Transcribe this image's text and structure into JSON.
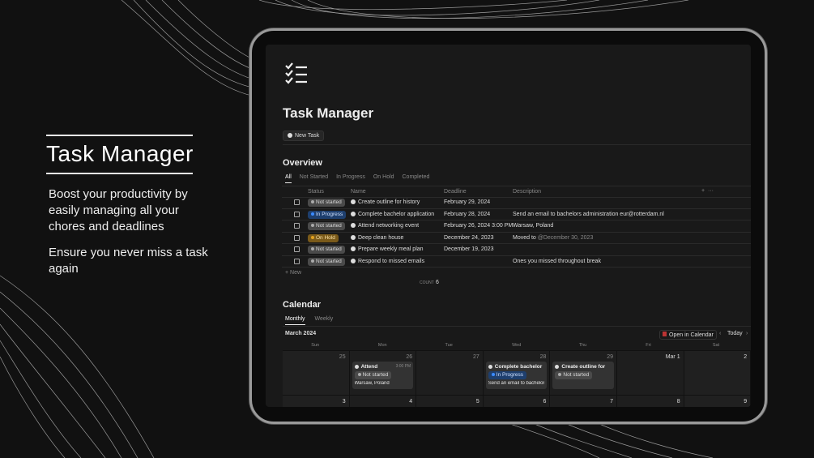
{
  "hero": {
    "title": "Task Manager",
    "paragraph1": "Boost your productivity by easily managing all your chores and deadlines",
    "paragraph2": "Ensure you never miss a task again"
  },
  "page": {
    "title": "Task Manager",
    "new_task_label": "New Task",
    "icon": "checklist-icon"
  },
  "overview": {
    "heading": "Overview",
    "tabs": [
      "All",
      "Not Started",
      "In Progress",
      "On Hold",
      "Completed"
    ],
    "columns": [
      "Status",
      "Name",
      "Deadline",
      "Description"
    ],
    "rows": [
      {
        "status": "Not started",
        "status_type": "ns",
        "name": "Create outline for history",
        "deadline": "February 29, 2024",
        "description": ""
      },
      {
        "status": "In Progress",
        "status_type": "ip",
        "name": "Complete bachelor application",
        "deadline": "February 28, 2024",
        "description": "Send an email to bachelors administration eur@rotterdam.nl"
      },
      {
        "status": "Not started",
        "status_type": "ns",
        "name": "Attend networking event",
        "deadline": "February 26, 2024 3:00 PM",
        "description": "Warsaw, Poland"
      },
      {
        "status": "On Hold",
        "status_type": "oh",
        "name": "Deep clean house",
        "deadline": "December 24, 2023",
        "description": "Moved to",
        "description_mention": "@December 30, 2023"
      },
      {
        "status": "Not started",
        "status_type": "ns",
        "name": "Prepare weekly meal plan",
        "deadline": "December 19, 2023",
        "description": ""
      },
      {
        "status": "Not started",
        "status_type": "ns",
        "name": "Respond to missed emails",
        "deadline": "",
        "description": "Ones you missed throughout break"
      }
    ],
    "new_label": "+ New",
    "count_label": "COUNT",
    "count": "6"
  },
  "calendar": {
    "heading": "Calendar",
    "tabs": [
      "Monthly",
      "Weekly"
    ],
    "month": "March 2024",
    "open_label": "Open in Calendar",
    "today_label": "Today",
    "weekdays": [
      "Sun",
      "Mon",
      "Tue",
      "Wed",
      "Thu",
      "Fri",
      "Sat"
    ],
    "week1": [
      "25",
      "26",
      "27",
      "28",
      "29",
      "Mar 1",
      "2"
    ],
    "week2": [
      "3",
      "4",
      "5",
      "6",
      "7",
      "8",
      "9"
    ],
    "cards": [
      {
        "title": "Attend",
        "time": "3:00 PM",
        "status": "Not started",
        "status_type": "ns",
        "desc": "Warsaw, Poland"
      },
      {
        "title": "Complete bachelor",
        "time": "",
        "status": "In Progress",
        "status_type": "ip",
        "desc": "Send an email to bachelors a"
      },
      {
        "title": "Create outline for",
        "time": "",
        "status": "Not started",
        "status_type": "ns",
        "desc": ""
      }
    ]
  }
}
